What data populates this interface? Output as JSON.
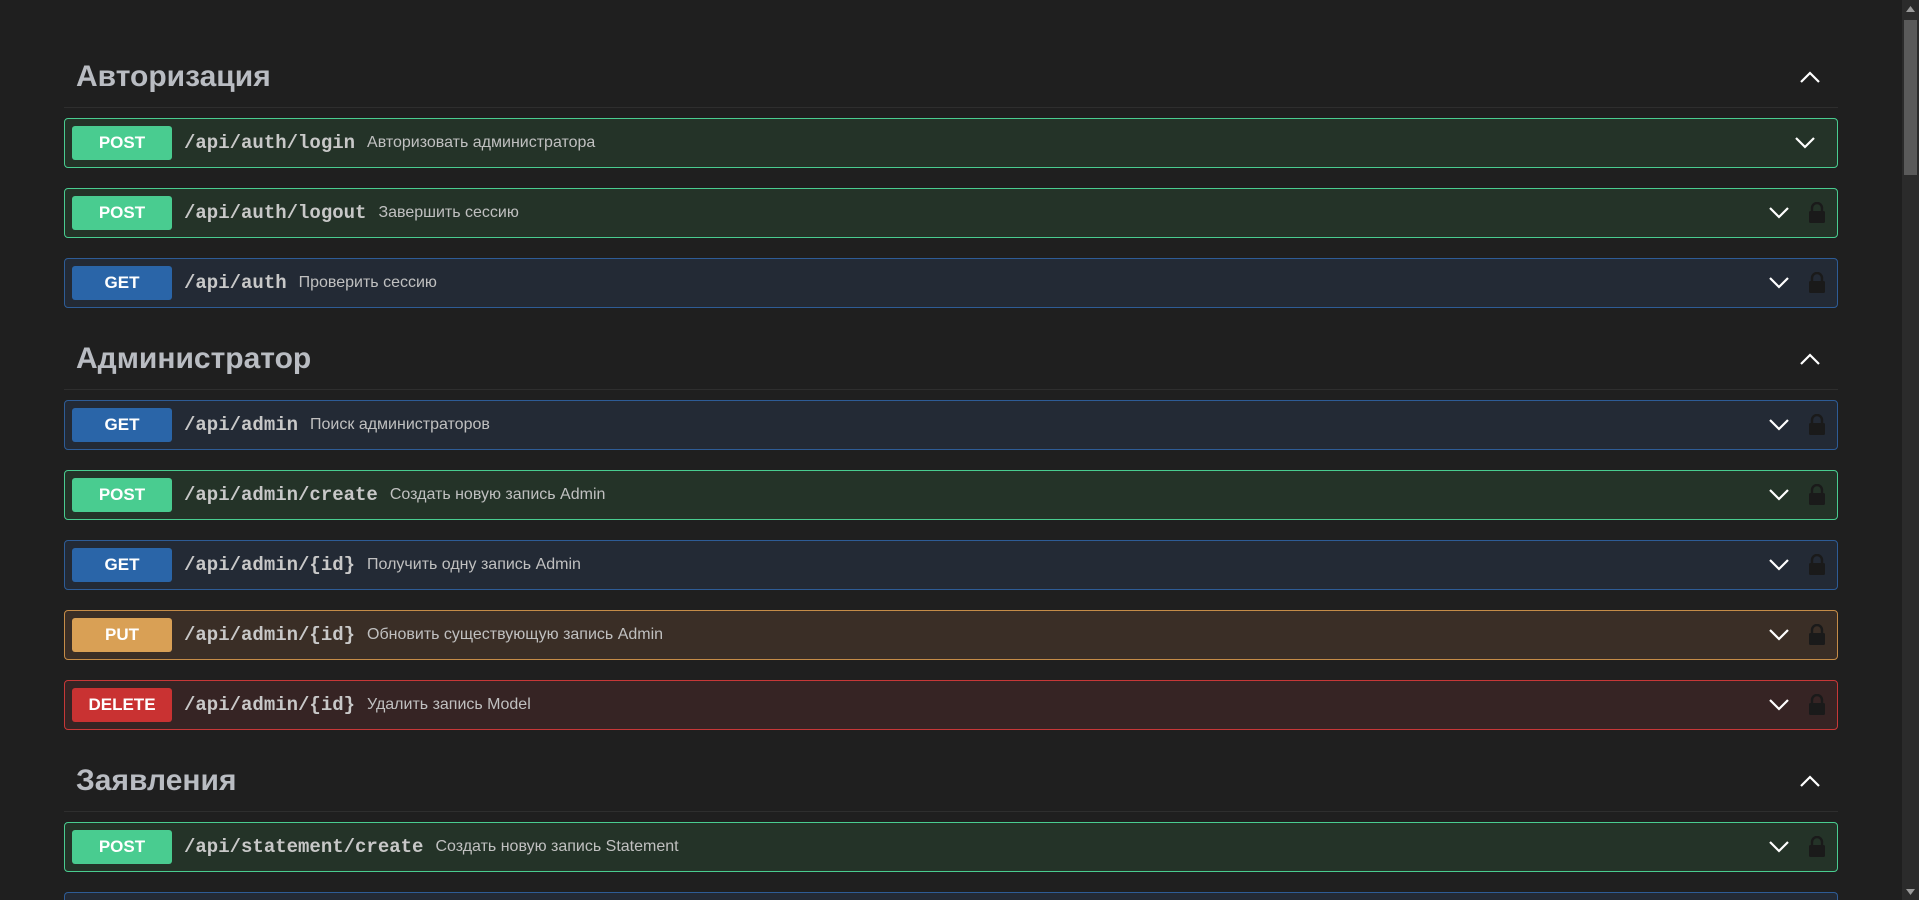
{
  "sections": [
    {
      "title": "Авторизация",
      "operations": [
        {
          "method": "POST",
          "path": "/api/auth/login",
          "summary": "Авторизовать администратора",
          "locked": false
        },
        {
          "method": "POST",
          "path": "/api/auth/logout",
          "summary": "Завершить сессию",
          "locked": true
        },
        {
          "method": "GET",
          "path": "/api/auth",
          "summary": "Проверить сессию",
          "locked": true
        }
      ]
    },
    {
      "title": "Администратор",
      "operations": [
        {
          "method": "GET",
          "path": "/api/admin",
          "summary": "Поиск администраторов",
          "locked": true
        },
        {
          "method": "POST",
          "path": "/api/admin/create",
          "summary": "Создать новую запись Admin",
          "locked": true
        },
        {
          "method": "GET",
          "path": "/api/admin/{id}",
          "summary": "Получить одну запись Admin",
          "locked": true
        },
        {
          "method": "PUT",
          "path": "/api/admin/{id}",
          "summary": "Обновить существующую запись Admin",
          "locked": true
        },
        {
          "method": "DELETE",
          "path": "/api/admin/{id}",
          "summary": "Удалить запись Model",
          "locked": true
        }
      ]
    },
    {
      "title": "Заявления",
      "operations": [
        {
          "method": "POST",
          "path": "/api/statement/create",
          "summary": "Создать новую запись Statement",
          "locked": true
        }
      ]
    }
  ],
  "colors": {
    "post": "#49cc90",
    "get": "#2a65a8",
    "put": "#d9a055",
    "delete": "#c93232",
    "background": "#1f1f1f"
  },
  "icons": {
    "section_toggle": "chevron-up-icon",
    "op_toggle": "chevron-down-icon",
    "lock": "lock-icon"
  }
}
